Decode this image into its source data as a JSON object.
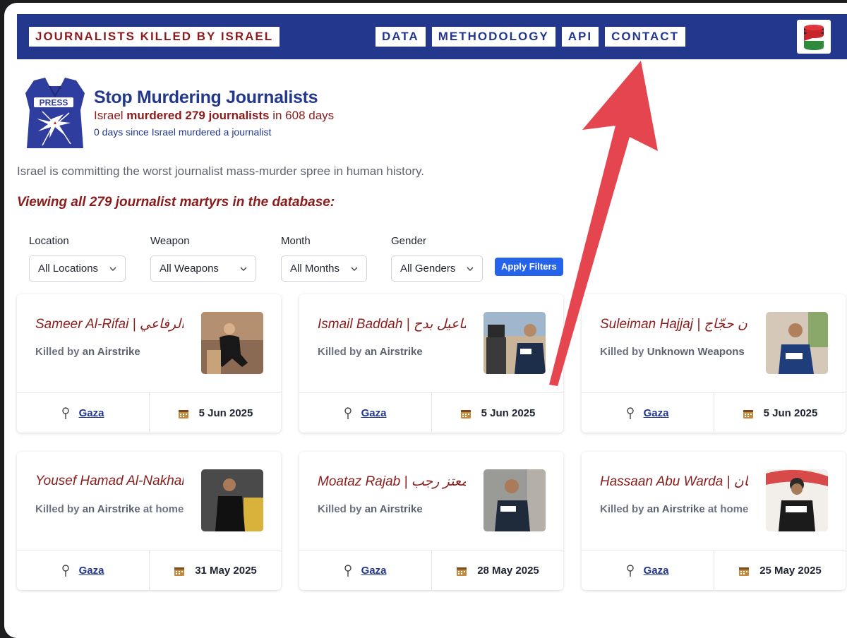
{
  "header": {
    "brand": "JOURNALISTS KILLED BY ISRAEL",
    "nav": [
      "DATA",
      "METHODOLOGY",
      "API",
      "CONTACT"
    ]
  },
  "hero": {
    "title": "Stop Murdering Journalists",
    "count_prefix": "Israel ",
    "count_bold": "murdered 279 journalists",
    "count_suffix": " in 608 days",
    "days_since": "0 days since Israel murdered a journalist",
    "press_text": "PRESS"
  },
  "tagline": "Israel is committing the worst journalist mass-murder spree in human history.",
  "viewing": "Viewing all 279 journalist martyrs in the database:",
  "filters": {
    "location": {
      "label": "Location",
      "value": "All Locations"
    },
    "weapon": {
      "label": "Weapon",
      "value": "All Weapons"
    },
    "month": {
      "label": "Month",
      "value": "All Months"
    },
    "gender": {
      "label": "Gender",
      "value": "All Genders"
    },
    "apply": "Apply Filters"
  },
  "cards": [
    {
      "name": "Sameer Al-Rifai | سمير الرفاعي",
      "killed_prefix": "Killed by ",
      "weapon": "an Airstrike",
      "suffix": "",
      "location": "Gaza",
      "date": "5 Jun 2025"
    },
    {
      "name": "Ismail Baddah | إسماعيل بدح",
      "killed_prefix": "Killed by ",
      "weapon": "an Airstrike",
      "suffix": "",
      "location": "Gaza",
      "date": "5 Jun 2025"
    },
    {
      "name": "Suleiman Hajjaj | سليمان حجّاج",
      "killed_prefix": "Killed by ",
      "weapon": "Unknown Weapons",
      "suffix": "",
      "location": "Gaza",
      "date": "5 Jun 2025"
    },
    {
      "name": "Yousef Hamad Al-Nakhala",
      "killed_prefix": "Killed by ",
      "weapon": "an Airstrike",
      "suffix": " at home",
      "location": "Gaza",
      "date": "31 May 2025"
    },
    {
      "name": "Moataz Rajab | معتز رجب",
      "killed_prefix": "Killed by ",
      "weapon": "an Airstrike",
      "suffix": "",
      "location": "Gaza",
      "date": "28 May 2025"
    },
    {
      "name": "Hassaan Abu Warda | حسان",
      "killed_prefix": "Killed by ",
      "weapon": "an Airstrike",
      "suffix": " at home",
      "location": "Gaza",
      "date": "25 May 2025"
    }
  ],
  "colors": {
    "navy": "#23388c",
    "maroon": "#8a1c1c",
    "arrow": "#e5454e",
    "button": "#2563eb"
  }
}
